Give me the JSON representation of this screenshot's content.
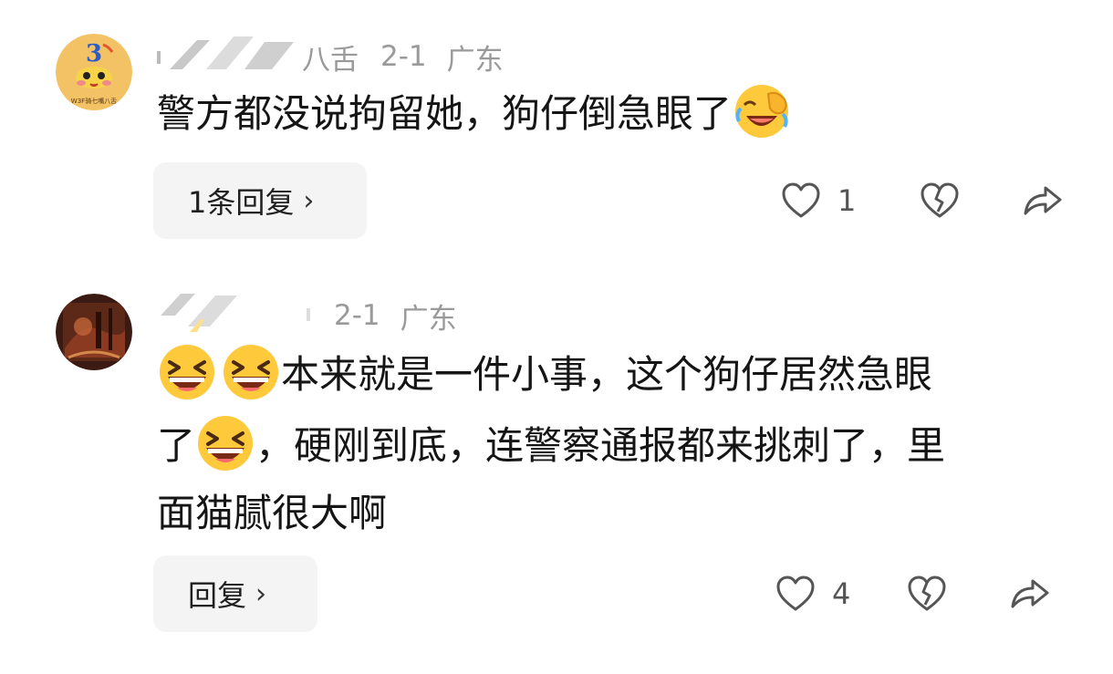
{
  "comments": [
    {
      "username_visible": "八舌",
      "date": "2-1",
      "location": "广东",
      "text_before_emoji": "警方都没说拘留她，狗仔倒急眼了",
      "emoji": "facepalm-laughing-emoji",
      "reply_label": "1条回复",
      "like_count": "1",
      "avatar_logo_text": "W3F骑七嘴八舌"
    },
    {
      "username_visible": "",
      "date": "2-1",
      "location": "广东",
      "line1_text": "本来就是一件小事，这个狗仔居然急眼",
      "line2_start": "了",
      "line2_rest": "，硬刚到底，连警察通报都来挑刺了，里",
      "line3_text": "面猫腻很大啊",
      "emoji": "grinning-squint-emoji",
      "reply_label": "回复",
      "like_count": "4"
    }
  ],
  "icons": {
    "like": "heart-outline-icon",
    "dislike": "broken-heart-icon",
    "share": "share-arrow-icon",
    "chevron": "chevron-right-icon"
  },
  "colors": {
    "meta_gray": "#9a9a9a",
    "button_bg": "#f4f4f4",
    "text": "#151515"
  }
}
